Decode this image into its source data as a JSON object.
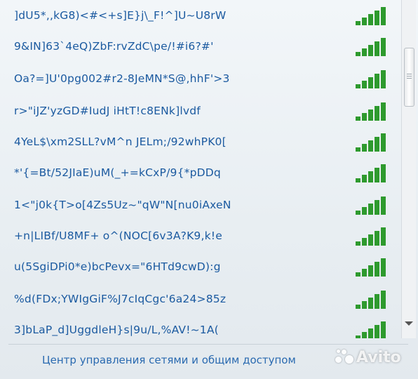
{
  "networks": [
    {
      "ssid": "]dU5*,,kG8)<#<+s]E}j\\_F!^]U~U8rW",
      "signal_bars": 5
    },
    {
      "ssid": "9&IN]63`4eQ)ZbF:rvZdC\\pe/!#i6?#'",
      "signal_bars": 5
    },
    {
      "ssid": "Oa?=]U'0pg002#r2-8JeMN*S@,hhF'>3",
      "signal_bars": 5
    },
    {
      "ssid": "r>\"iJZ'yzGD#IudJ iHtT!c8ENk]lvdf",
      "signal_bars": 5
    },
    {
      "ssid": "4YeL$\\xm2SLL?vM^n JELm;/92whPK0[",
      "signal_bars": 5
    },
    {
      "ssid": "*'{=Bt/52JIaE)uM(_+=kCxP/9{*pDDq",
      "signal_bars": 5
    },
    {
      "ssid": "1<\"j0k{T>o[4Zs5Uz~\"qW\"N[nu0iAxeN",
      "signal_bars": 5
    },
    {
      "ssid": "+n|LIBf/U8MF+ o^(NOC[6v3A?K9,k!e",
      "signal_bars": 5
    },
    {
      "ssid": "u(5SgiDPi0*e)bcPevx=\"6HTd9cwD):g",
      "signal_bars": 5
    },
    {
      "ssid": "%d(FDx;YWIgGiF%J7cIqCgc'6a24>85z",
      "signal_bars": 5
    },
    {
      "ssid": "3]bLaP_d]UggdleH}s|9u/L,%AV!~1A(",
      "signal_bars": 5
    }
  ],
  "footer": {
    "link_label": "Центр управления сетями и общим доступом"
  },
  "watermark": {
    "text": "Avito"
  },
  "colors": {
    "ssid_text": "#1b5aa0",
    "signal_bar": "#2e9a2e",
    "link": "#2a6ab0"
  }
}
